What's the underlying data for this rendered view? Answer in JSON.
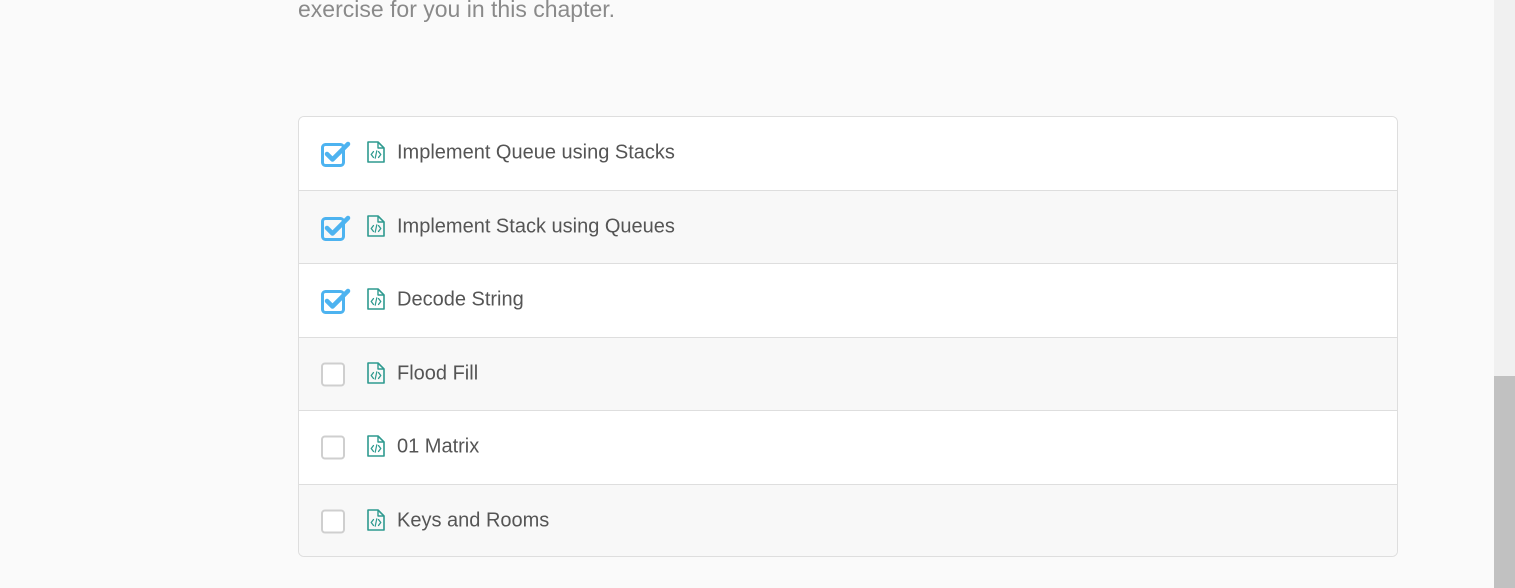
{
  "intro": {
    "text": "exercise for you in this chapter."
  },
  "items": [
    {
      "label": "Implement Queue using Stacks",
      "completed": true
    },
    {
      "label": "Implement Stack using Queues",
      "completed": true
    },
    {
      "label": "Decode String",
      "completed": true
    },
    {
      "label": "Flood Fill",
      "completed": false
    },
    {
      "label": "01 Matrix",
      "completed": false
    },
    {
      "label": "Keys and Rooms",
      "completed": false
    }
  ],
  "colors": {
    "check_blue": "#4db3f0",
    "file_icon_teal": "#2e9a8f",
    "unchecked_border": "#cfcfcf"
  },
  "icons": {
    "completed": "checked-checkbox-icon",
    "pending": "unchecked-checkbox-icon",
    "item": "code-file-icon"
  }
}
